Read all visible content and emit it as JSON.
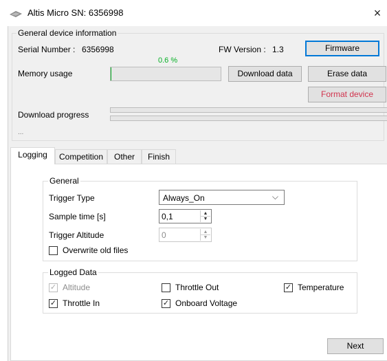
{
  "window": {
    "title": "Altis Micro  SN: 6356998",
    "close_glyph": "×",
    "icon": "app-logo-icon"
  },
  "device_info": {
    "legend": "General device information",
    "serial_label": "Serial Number :",
    "serial_value": "6356998",
    "fw_label": "FW Version :",
    "fw_value": "1.3",
    "firmware_button": "Firmware",
    "memory_label": "Memory usage",
    "memory_percent_text": "0.6 %",
    "memory_percent": 0.6,
    "download_button": "Download data",
    "erase_button": "Erase data",
    "format_button": "Format device",
    "download_progress_label": "Download progress",
    "status_text": "...",
    "download_progress": 0,
    "accent_color": "#06b025",
    "danger_color": "#d1344e"
  },
  "tabs": [
    {
      "label": "Logging",
      "active": true
    },
    {
      "label": "Competition",
      "active": false
    },
    {
      "label": "Other",
      "active": false
    },
    {
      "label": "Finish",
      "active": false
    }
  ],
  "logging": {
    "general": {
      "legend": "General",
      "trigger_type_label": "Trigger Type",
      "trigger_type_value": "Always_On",
      "sample_time_label": "Sample time [s]",
      "sample_time_value": "0,1",
      "trigger_altitude_label": "Trigger Altitude",
      "trigger_altitude_value": "0",
      "overwrite_label": "Overwrite old files",
      "overwrite_checked": false
    },
    "logged_data": {
      "legend": "Logged Data",
      "items": [
        {
          "label": "Altitude",
          "checked": true,
          "enabled": false
        },
        {
          "label": "Throttle Out",
          "checked": false,
          "enabled": true
        },
        {
          "label": "Temperature",
          "checked": true,
          "enabled": true
        },
        {
          "label": "Throttle In",
          "checked": true,
          "enabled": true
        },
        {
          "label": "Onboard Voltage",
          "checked": true,
          "enabled": true
        }
      ]
    }
  },
  "footer": {
    "next_button": "Next"
  }
}
